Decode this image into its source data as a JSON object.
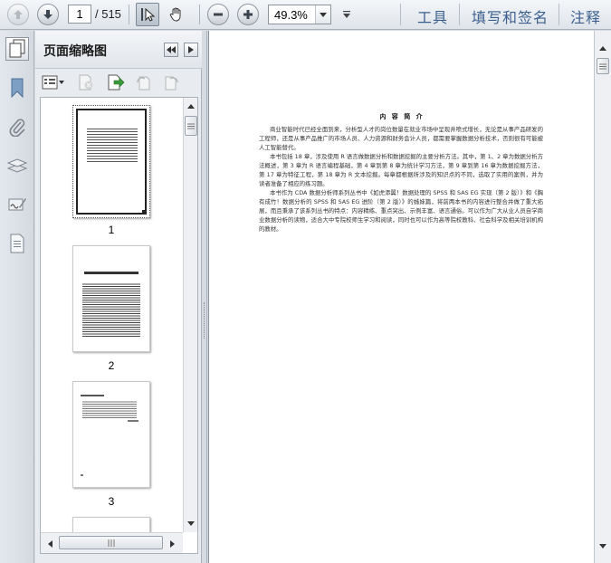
{
  "toolbar": {
    "current_page": "1",
    "page_total": "/ 515",
    "zoom": "49.3%",
    "tools_label": "工具",
    "sign_label": "填写和签名",
    "comment_label": "注释"
  },
  "thumbnails_panel": {
    "title": "页面缩略图",
    "pages": [
      {
        "number": "1"
      },
      {
        "number": "2"
      },
      {
        "number": "3"
      }
    ]
  },
  "document": {
    "title": "内 容 简 介",
    "paragraphs": [
      "商业智能时代已经全面到来，分析型人才的岗位数量在就业市场中呈现井喷式增长，无论是从事产品研发的工程师，还是从事产品推广的市场人员、人力资源和财务会计人员，都需要掌握数据分析技术，否则很有可能被人工智能替代。",
      "本书包括 18 章，涉及使用 R 语言做数据分析和数据挖掘的主要分析方法。其中，第 1、2 章为数据分析方法概述，第 3 章为 R 语言编程基础，第 4 章到第 8 章为统计学习方法，第 9 章到第 16 章为数据挖掘方法，第 17 章为特征工程，第 18 章为 R 文本挖掘。每章都根据所涉及的知识点的不同，选取了实用的案例，并为读者准备了相应的练习题。",
      "本书作为 CDA 数据分析师系列丛书中《如虎添翼！数据处理的 SPSS 和 SAS EG 实现（第 2 版）》和《胸有成竹！数据分析的 SPSS 和 SAS EG 进阶（第 2 版）》的姊妹篇，将前两本书的内容进行整合并做了重大拓展，而且秉承了该系列丛书的特点：内容精练、重点突出、示例丰富、语言通俗。可以作为广大从业人员自学商业数据分析的读物，适合大中专院校师生学习和阅读，同时也可以作为高等院校教科、社会科学及相关培训机构的教材。"
    ]
  },
  "colors": {
    "toolbar_link": "#3b5f8f",
    "panel_background": "#e8ebef",
    "chrome": "#d6dbe2"
  },
  "icons": [
    "arrow-up-icon",
    "arrow-down-icon",
    "select-cursor-icon",
    "hand-icon",
    "zoom-out-icon",
    "zoom-in-icon",
    "bookmark-icon",
    "paperclip-icon",
    "layers-icon",
    "signature-icon",
    "page-icon",
    "thumbnail-options-icon",
    "delete-page-icon",
    "insert-page-icon",
    "rotate-ccw-icon",
    "rotate-cw-icon"
  ]
}
